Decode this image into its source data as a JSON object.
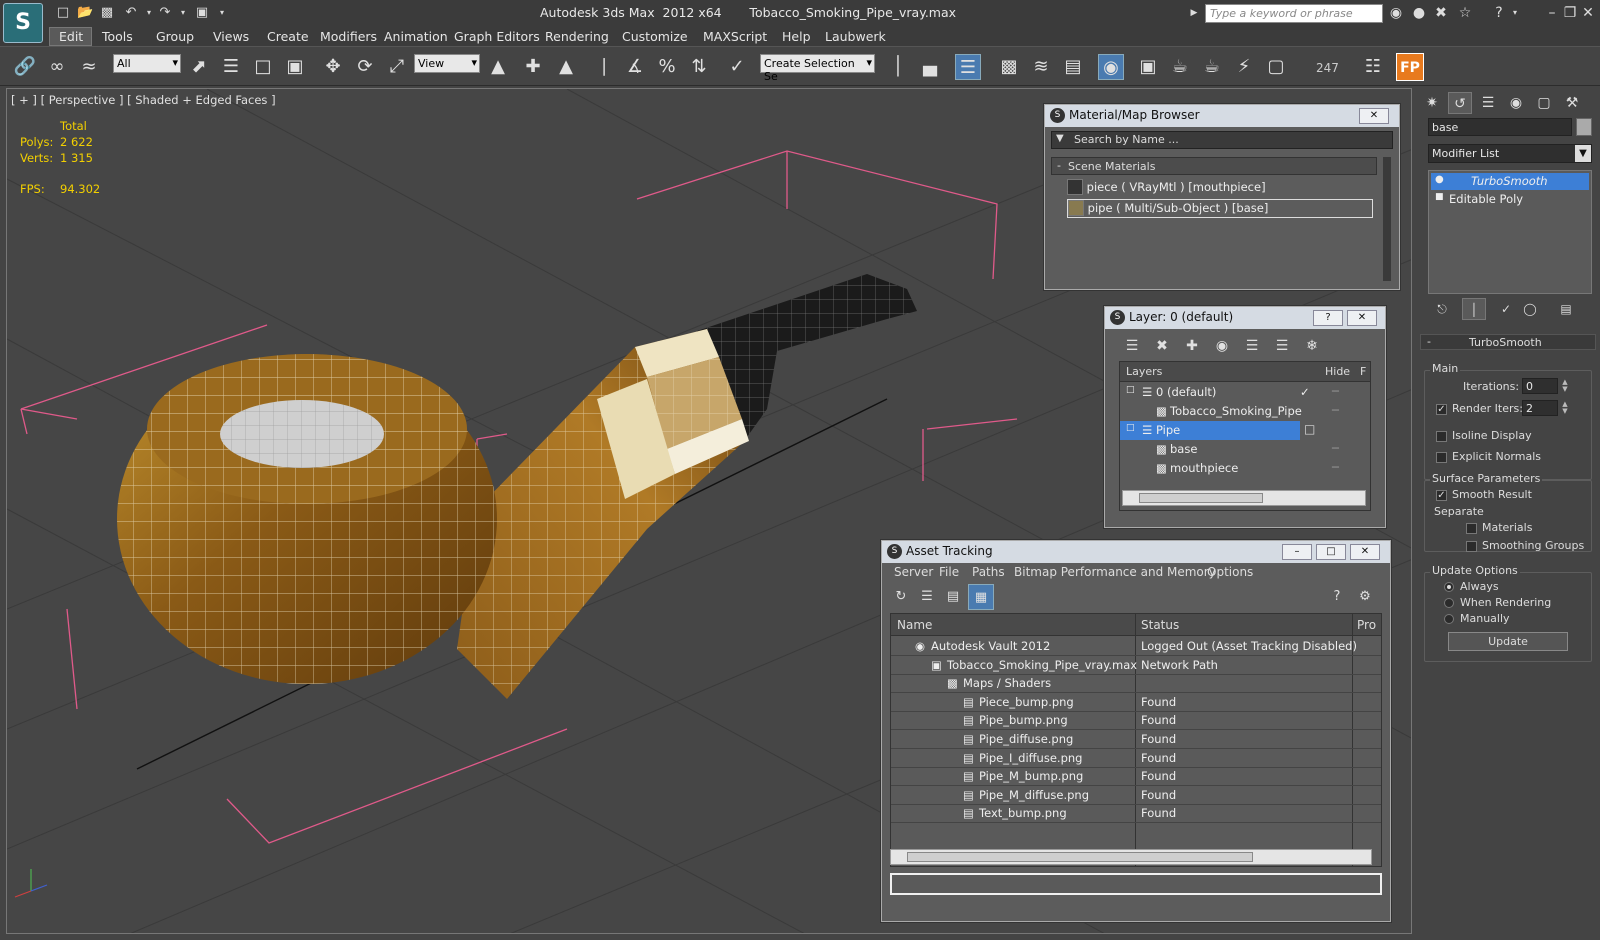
{
  "app": {
    "window_title": "Autodesk 3ds Max  2012 x64       Tobacco_Smoking_Pipe_vray.max",
    "search_placeholder": "Type a keyword or phrase"
  },
  "menu": [
    "Edit",
    "Tools",
    "Group",
    "Views",
    "Create",
    "Modifiers",
    "Animation",
    "Graph Editors",
    "Rendering",
    "Customize",
    "MAXScript",
    "Help",
    "Laubwerk"
  ],
  "toolbar": {
    "filter": "All",
    "ref_coord": "View",
    "selection_set": "Create Selection Se",
    "counter": "247",
    "fp_label": "FP"
  },
  "viewport": {
    "label": "[ + ] [ Perspective ] [ Shaded + Edged Faces ]",
    "stats_header": "Total",
    "polys_label": "Polys:",
    "polys_value": "2 622",
    "verts_label": "Verts:",
    "verts_value": "1 315",
    "fps_label": "FPS:",
    "fps_value": "94.302"
  },
  "material_browser": {
    "title": "Material/Map Browser",
    "search_placeholder": "Search by Name ...",
    "section": "Scene Materials",
    "items": [
      "piece  ( VRayMtl ) [mouthpiece]",
      "pipe  ( Multi/Sub-Object ) [base]"
    ]
  },
  "layer_window": {
    "title": "Layer: 0 (default)",
    "col_layers": "Layers",
    "col_hide": "Hide",
    "col_f": "F",
    "rows": [
      {
        "label": "0 (default)",
        "indent": 0
      },
      {
        "label": "Tobacco_Smoking_Pipe",
        "indent": 1
      },
      {
        "label": "Pipe",
        "indent": 0
      },
      {
        "label": "base",
        "indent": 1
      },
      {
        "label": "mouthpiece",
        "indent": 1
      }
    ]
  },
  "asset_tracking": {
    "title": "Asset Tracking",
    "menu": [
      "Server",
      "File",
      "Paths",
      "Bitmap Performance and Memory",
      "Options"
    ],
    "col_name": "Name",
    "col_status": "Status",
    "col_pro": "Pro",
    "rows": [
      {
        "name": "Autodesk Vault 2012",
        "status": "Logged Out (Asset Tracking Disabled)",
        "indent": 1
      },
      {
        "name": "Tobacco_Smoking_Pipe_vray.max",
        "status": "Network Path",
        "indent": 2
      },
      {
        "name": "Maps / Shaders",
        "status": "",
        "indent": 3
      },
      {
        "name": "Piece_bump.png",
        "status": "Found",
        "indent": 4
      },
      {
        "name": "Pipe_bump.png",
        "status": "Found",
        "indent": 4
      },
      {
        "name": "Pipe_diffuse.png",
        "status": "Found",
        "indent": 4
      },
      {
        "name": "Pipe_I_diffuse.png",
        "status": "Found",
        "indent": 4
      },
      {
        "name": "Pipe_M_bump.png",
        "status": "Found",
        "indent": 4
      },
      {
        "name": "Pipe_M_diffuse.png",
        "status": "Found",
        "indent": 4
      },
      {
        "name": "Text_bump.png",
        "status": "Found",
        "indent": 4
      }
    ]
  },
  "command_panel": {
    "object_name": "base",
    "modifier_list": "Modifier List",
    "stack": [
      "TurboSmooth",
      "Editable Poly"
    ],
    "rollout_title": "TurboSmooth",
    "main_label": "Main",
    "iterations_label": "Iterations:",
    "iterations_value": "0",
    "render_iters_label": "Render Iters:",
    "render_iters_value": "2",
    "isoline_label": "Isoline Display",
    "explicit_normals_label": "Explicit Normals",
    "surface_params_label": "Surface Parameters",
    "smooth_result_label": "Smooth Result",
    "separate_label": "Separate",
    "materials_label": "Materials",
    "smoothing_groups_label": "Smoothing Groups",
    "update_options_label": "Update Options",
    "always_label": "Always",
    "when_rendering_label": "When Rendering",
    "manually_label": "Manually",
    "update_button": "Update"
  },
  "colors": {
    "accent_blue": "#3d7fd6",
    "selection_bracket": "#e05a8a",
    "stats_yellow": "#f3d000"
  }
}
